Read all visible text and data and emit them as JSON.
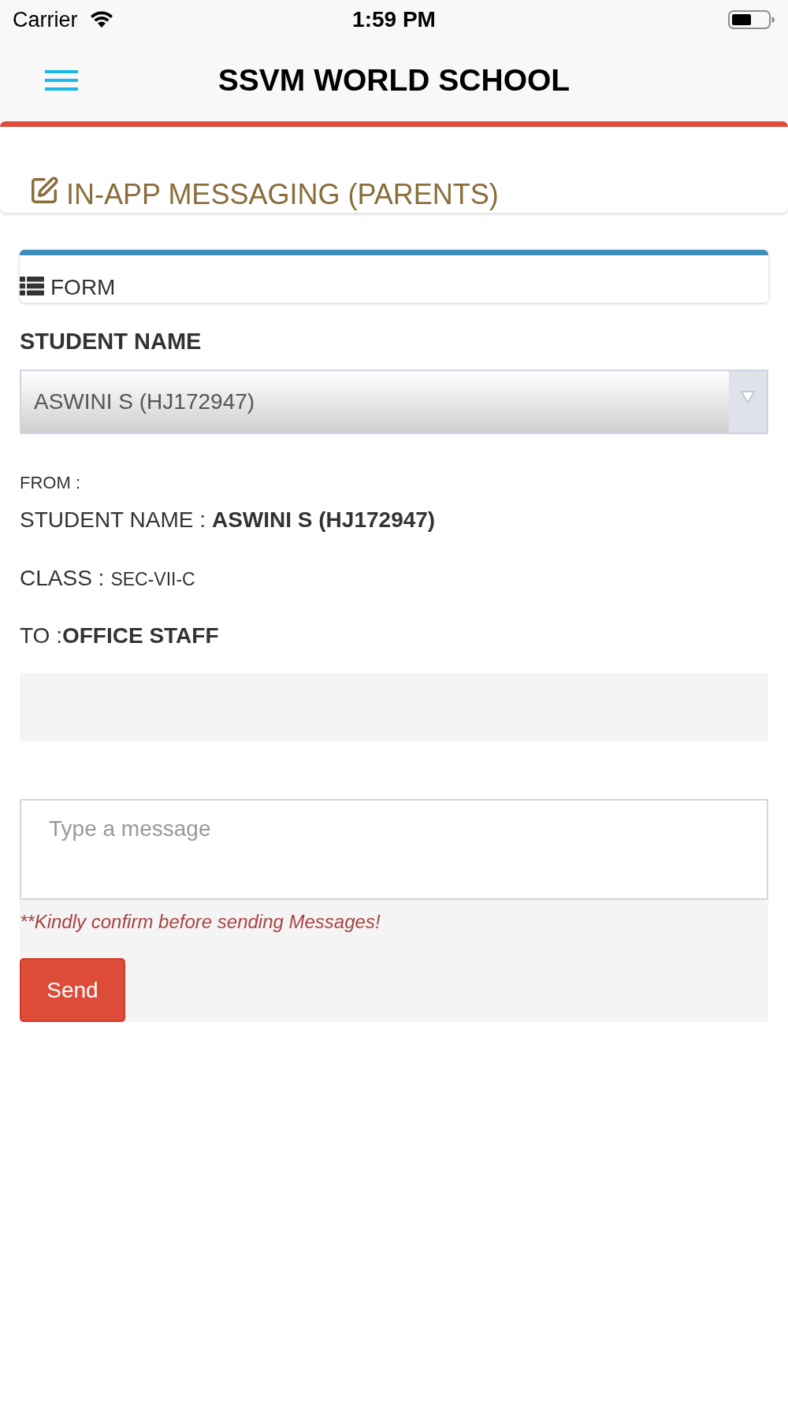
{
  "status_bar": {
    "carrier": "Carrier",
    "time": "1:59 PM"
  },
  "nav_bar": {
    "title": "SSVM WORLD SCHOOL"
  },
  "page_header": {
    "title": "IN-APP MESSAGING (PARENTS)"
  },
  "form_panel": {
    "title": "FORM"
  },
  "student_select": {
    "label": "STUDENT NAME",
    "value": "ASWINI S (HJ172947)"
  },
  "details": {
    "from_label": "FROM :",
    "rows": [
      {
        "kind": "name",
        "label": "STUDENT NAME :",
        "value": "ASWINI S (HJ172947)"
      },
      {
        "kind": "class",
        "label": "CLASS :",
        "value": "SEC-VII-C"
      },
      {
        "kind": "recipient",
        "label": "TO :",
        "value": "OFFICE STAFF"
      }
    ]
  },
  "message": {
    "placeholder": "Type a message",
    "warning": "**Kindly confirm before sending Messages!",
    "send_button": "Send"
  }
}
